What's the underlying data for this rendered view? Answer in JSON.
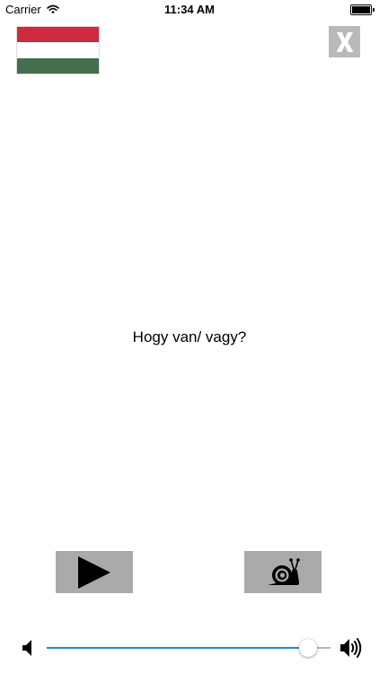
{
  "status_bar": {
    "carrier": "Carrier",
    "time": "11:34 AM",
    "battery_level": 1.0
  },
  "flag": {
    "icon": "hungary-flag-icon",
    "colors": [
      "#cd2a3e",
      "#ffffff",
      "#436f4d"
    ]
  },
  "close_button": {
    "icon": "x-icon",
    "background": "#b9b9b9"
  },
  "phrase": {
    "text": "Hogy van/ vagy?"
  },
  "controls": {
    "play_icon": "play-icon",
    "slow_icon": "snail-icon",
    "button_color": "#aaaaaa"
  },
  "volume": {
    "level": 0.92,
    "accent": "#1e8bd8"
  }
}
